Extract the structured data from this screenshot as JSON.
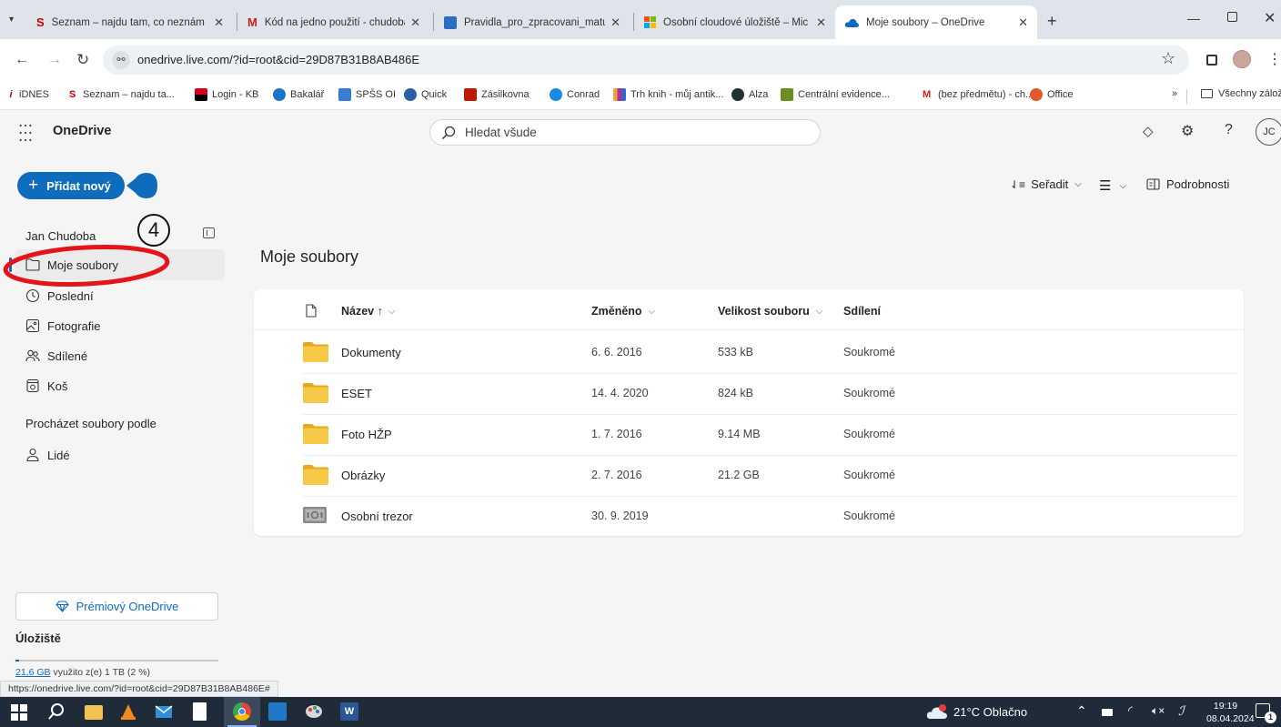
{
  "browser": {
    "tabs": [
      {
        "title": "Seznam – najdu tam, co neznám",
        "icon": "seznam-s-icon"
      },
      {
        "title": "Kód na jedno použití - chudoba",
        "icon": "gmail-icon"
      },
      {
        "title": "Pravidla_pro_zpracovani_maturi",
        "icon": "word-doc-icon"
      },
      {
        "title": "Osobní cloudové úložiště – Mic",
        "icon": "microsoft-icon"
      },
      {
        "title": "Moje soubory – OneDrive",
        "icon": "onedrive-icon",
        "active": true
      }
    ],
    "url": "onedrive.live.com/?id=root&cid=29D87B31B8AB486E",
    "bookmarks": [
      "iDNES",
      "Seznam – najdu ta...",
      "Login - KB",
      "Bakalář",
      "SPŠS OI",
      "Quick",
      "Zásilkovna",
      "Conrad",
      "Trh knih - můj antik...",
      "Alza",
      "Centrální evidence...",
      "(bez předmětu) - ch...",
      "Office"
    ],
    "all_bookmarks": "Všechny záložky",
    "overflow": "»",
    "status_url": "https://onedrive.live.com/?id=root&cid=29D87B31B8AB486E#"
  },
  "app": {
    "name": "OneDrive",
    "search_placeholder": "Hledat všude",
    "avatar": "JC",
    "help": "?"
  },
  "sidebar": {
    "add_new": "Přidat nový",
    "user": "Jan Chudoba",
    "annotation_number": "4",
    "items": [
      {
        "label": "Moje soubory",
        "icon": "folder-icon"
      },
      {
        "label": "Poslední",
        "icon": "clock-icon"
      },
      {
        "label": "Fotografie",
        "icon": "photo-icon"
      },
      {
        "label": "Sdílené",
        "icon": "people-icon"
      },
      {
        "label": "Koš",
        "icon": "recycle-bin-icon"
      }
    ],
    "browse_heading": "Procházet soubory podle",
    "browse_items": [
      {
        "label": "Lidé",
        "icon": "person-icon"
      }
    ],
    "premium": "Prémiový OneDrive",
    "storage_heading": "Úložiště",
    "storage_used": "21,6 GB",
    "storage_text": " využito z(e) 1 TB (2 %)",
    "storage_fraction": 0.02
  },
  "toolbar": {
    "sort": "Seřadit",
    "details": "Podrobnosti"
  },
  "main": {
    "title": "Moje soubory",
    "columns": {
      "name": "Název ↑",
      "modified": "Změněno",
      "size": "Velikost souboru",
      "sharing": "Sdílení"
    },
    "rows": [
      {
        "name": "Dokumenty",
        "modified": "6. 6. 2016",
        "size": "533 kB",
        "sharing": "Soukromé",
        "icon": "folder-icon"
      },
      {
        "name": "ESET",
        "modified": "14. 4. 2020",
        "size": "824 kB",
        "sharing": "Soukromé",
        "icon": "folder-icon"
      },
      {
        "name": "Foto HŽP",
        "modified": "1. 7. 2016",
        "size": "9.14 MB",
        "sharing": "Soukromé",
        "icon": "folder-icon"
      },
      {
        "name": "Obrázky",
        "modified": "2. 7. 2016",
        "size": "21.2 GB",
        "sharing": "Soukromé",
        "icon": "folder-icon"
      },
      {
        "name": "Osobní trezor",
        "modified": "30. 9. 2019",
        "size": "",
        "sharing": "Soukromé",
        "icon": "vault-icon"
      }
    ]
  },
  "taskbar": {
    "weather": "21°C Oblačno",
    "time": "19:19",
    "date": "08.04.2024",
    "notifications": "1"
  },
  "colors": {
    "accent": "#0f6cbd",
    "annotation": "#e4141b",
    "folder": "#f7c948",
    "taskbar": "#1f2b38"
  }
}
